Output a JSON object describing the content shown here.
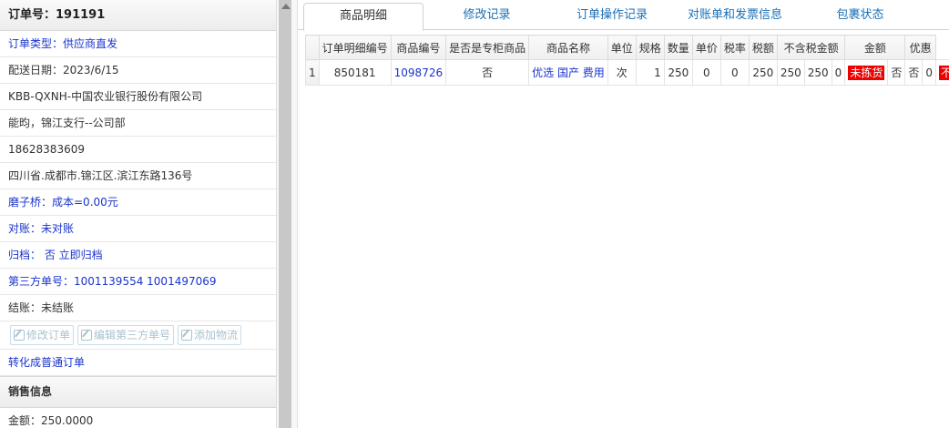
{
  "order": {
    "header": "订单号：191191",
    "type": "订单类型：供应商直发",
    "delivery_date": "配送日期：2023/6/15",
    "customer": "KBB-QXNH-中国农业银行股份有限公司",
    "contact": "能昀，锦江支行--公司部",
    "phone": "18628383609",
    "address": "四川省.成都市.锦江区.滨江东路136号",
    "cost": "磨子桥：成本=0.00元",
    "reconcile": "对账：未对账",
    "archive": "归档： 否 立即归档",
    "third_party": "第三方单号：1001139554 1001497069",
    "settle": "结账：未结账",
    "buttons": {
      "modify": "修改订单",
      "edit_third": "编辑第三方单号",
      "add_logistics": "添加物流"
    },
    "convert": "转化成普通订单"
  },
  "sales": {
    "title": "销售信息",
    "amount": "金额：250.0000"
  },
  "tabs": [
    "商品明细",
    "修改记录",
    "订单操作记录",
    "对账单和发票信息",
    "包裹状态"
  ],
  "grid": {
    "headers": [
      "",
      "订单明细编号",
      "商品编号",
      "是否是专柜商品",
      "商品名称",
      "单位",
      "规格",
      "数量",
      "单价",
      "税率",
      "税额",
      "不含税金额",
      "金额",
      "优惠"
    ],
    "rows": [
      {
        "idx": "1",
        "detail_id": "850181",
        "product_id": "1098726",
        "counter": "否",
        "name": "优选 国产 费用",
        "unit": "次",
        "spec": "1",
        "qty": "250",
        "price": "0",
        "tax_rate": "0",
        "tax": "250",
        "net": "250",
        "amount": "250",
        "discount": "0",
        "status1": "未拣货",
        "c16": "否",
        "c17": "否",
        "c18": "0",
        "status2": "不足"
      }
    ]
  },
  "colors": {
    "link": "#1a33cc",
    "tab": "#1a6fb5",
    "alert": "#ee0000"
  }
}
